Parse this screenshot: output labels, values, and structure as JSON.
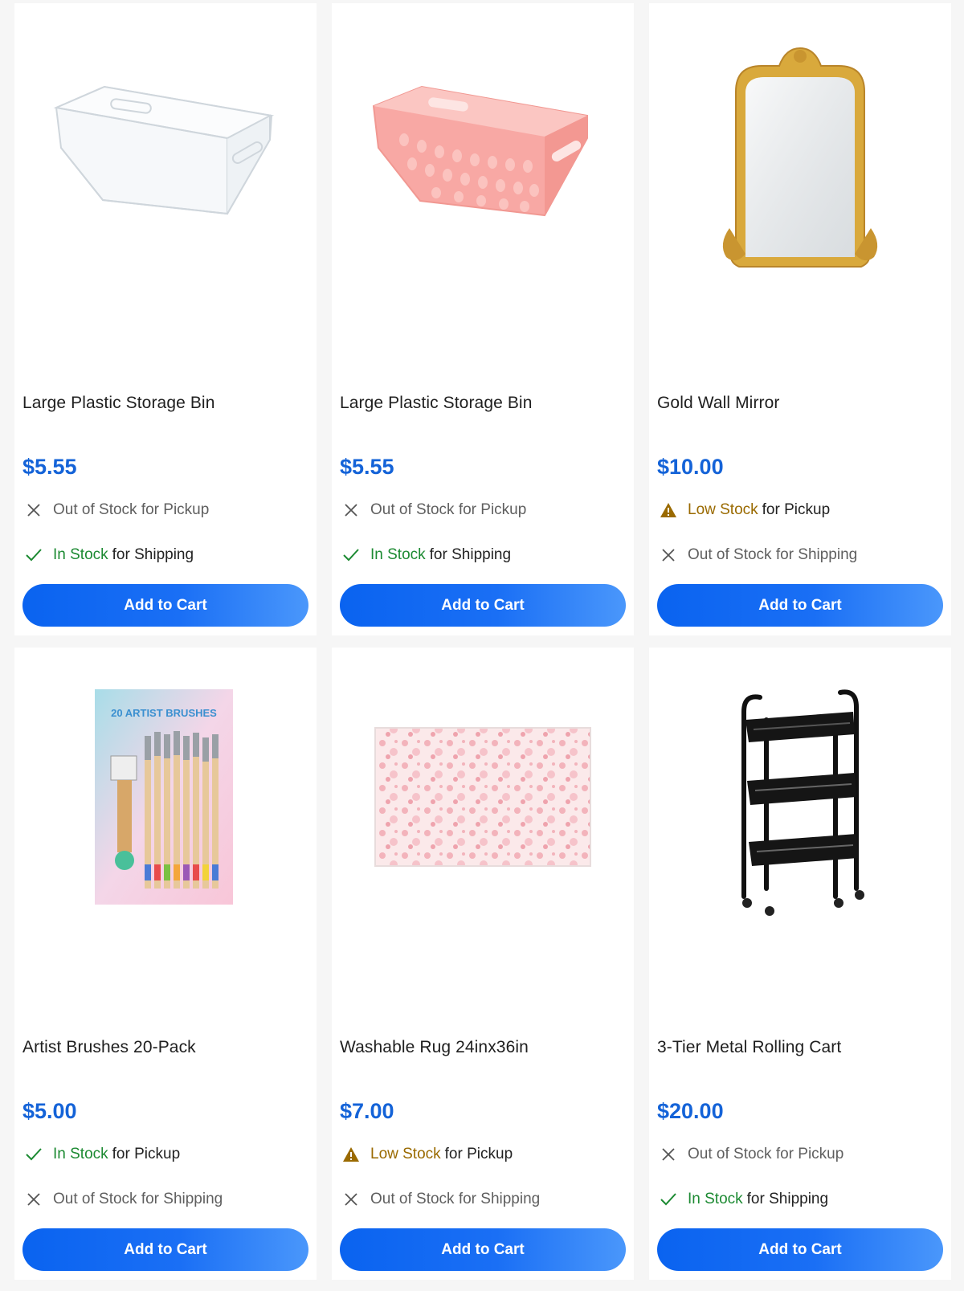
{
  "products": [
    {
      "title": "Large Plastic Storage Bin",
      "price": "$5.55",
      "pickup": {
        "state": "out",
        "text": "Out of Stock for Pickup"
      },
      "shipping": {
        "state": "in",
        "highlight": "In Stock",
        "rest": "for Shipping"
      },
      "button": "Add to Cart",
      "image_icon": "clear-storage-bin-image"
    },
    {
      "title": "Large Plastic Storage Bin",
      "price": "$5.55",
      "pickup": {
        "state": "out",
        "text": "Out of Stock for Pickup"
      },
      "shipping": {
        "state": "in",
        "highlight": "In Stock",
        "rest": "for Shipping"
      },
      "button": "Add to Cart",
      "image_icon": "pink-storage-bin-image"
    },
    {
      "title": "Gold Wall Mirror",
      "price": "$10.00",
      "pickup": {
        "state": "low",
        "highlight": "Low Stock",
        "rest": "for Pickup"
      },
      "shipping": {
        "state": "out",
        "text": "Out of Stock for Shipping"
      },
      "button": "Add to Cart",
      "image_icon": "gold-mirror-image"
    },
    {
      "title": "Artist Brushes 20-Pack",
      "price": "$5.00",
      "pickup": {
        "state": "in",
        "highlight": "In Stock",
        "rest": "for Pickup"
      },
      "shipping": {
        "state": "out",
        "text": "Out of Stock for Shipping"
      },
      "button": "Add to Cart",
      "image_icon": "artist-brushes-image",
      "image_text": "20 ARTIST BRUSHES"
    },
    {
      "title": "Washable Rug 24inx36in",
      "price": "$7.00",
      "pickup": {
        "state": "low",
        "highlight": "Low Stock",
        "rest": "for Pickup"
      },
      "shipping": {
        "state": "out",
        "text": "Out of Stock for Shipping"
      },
      "button": "Add to Cart",
      "image_icon": "pink-floral-rug-image"
    },
    {
      "title": "3-Tier Metal Rolling Cart",
      "price": "$20.00",
      "pickup": {
        "state": "out",
        "text": "Out of Stock for Pickup"
      },
      "shipping": {
        "state": "in",
        "highlight": "In Stock",
        "rest": "for Shipping"
      },
      "button": "Add to Cart",
      "image_icon": "rolling-cart-image"
    }
  ],
  "colors": {
    "price": "#1463d8",
    "in_stock": "#1c8a32",
    "low_stock": "#9a6a00",
    "button": "#0a63f0"
  }
}
